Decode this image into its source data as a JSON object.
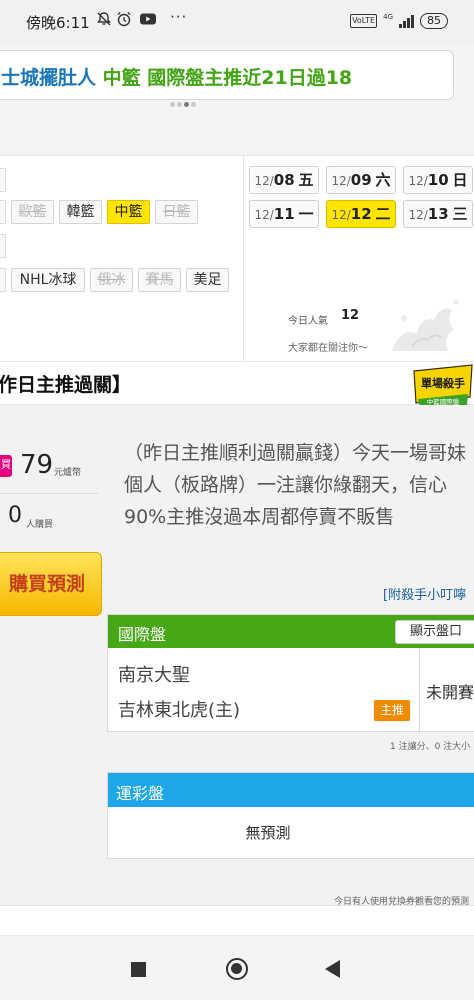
{
  "status_bar": {
    "time": "傍晚6:11",
    "more": "···",
    "network": "4G",
    "volte": "VoLTE",
    "battery": "85"
  },
  "banner": {
    "part1": "士城擺肚人",
    "part2": "中籃 國際盤主推近21日過18"
  },
  "sports_row1": [
    {
      "label": "歐籃",
      "state": "dim"
    },
    {
      "label": "韓籃",
      "state": "normal"
    },
    {
      "label": "中籃",
      "state": "active"
    },
    {
      "label": "日籃",
      "state": "dim"
    }
  ],
  "sports_row2": [
    {
      "label": "NHL冰球",
      "state": "normal"
    },
    {
      "label": "俄冰",
      "state": "dim"
    },
    {
      "label": "賽馬",
      "state": "dim"
    },
    {
      "label": "美足",
      "state": "normal"
    }
  ],
  "dates": [
    {
      "md": "12/",
      "day": "08",
      "wd": "五",
      "active": false
    },
    {
      "md": "12/",
      "day": "09",
      "wd": "六",
      "active": false
    },
    {
      "md": "12/",
      "day": "10",
      "wd": "日",
      "active": false
    },
    {
      "md": "12/",
      "day": "11",
      "wd": "一",
      "active": false
    },
    {
      "md": "12/",
      "day": "12",
      "wd": "二",
      "active": true
    },
    {
      "md": "12/",
      "day": "13",
      "wd": "三",
      "active": false
    }
  ],
  "popularity": {
    "label": "今日人氣",
    "value": "12",
    "sub": "大家都在關注你～"
  },
  "section": {
    "title": "作日主推過關】",
    "badge_line1": "單場殺手",
    "badge_line2": "中籃國際盤"
  },
  "offer": {
    "tag": "買",
    "price": "79",
    "price_unit": "元爐幣",
    "buyers": "0",
    "buyers_unit": "人購買",
    "buy_button": "購買預測"
  },
  "description": "（昨日主推順利過關贏錢）今天一場哥妹個人（板路牌）一注讓你綠翻天，信心90%主推沒過本周都停賣不販售",
  "killer_link": "[附殺手小叮嚀",
  "intl_panel": {
    "label": "國際盤",
    "show_button": "顯示盤口",
    "team1": "南京大聖",
    "team2": "吉林東北虎(主)",
    "pick_tag": "主推",
    "status": "未開賽"
  },
  "intl_note": "1 注讓分、0 注大小",
  "lottery_panel": {
    "label": "運彩盤",
    "content": "無預測"
  },
  "footer_note": "今日有人使用兌換券觀看您的預測"
}
